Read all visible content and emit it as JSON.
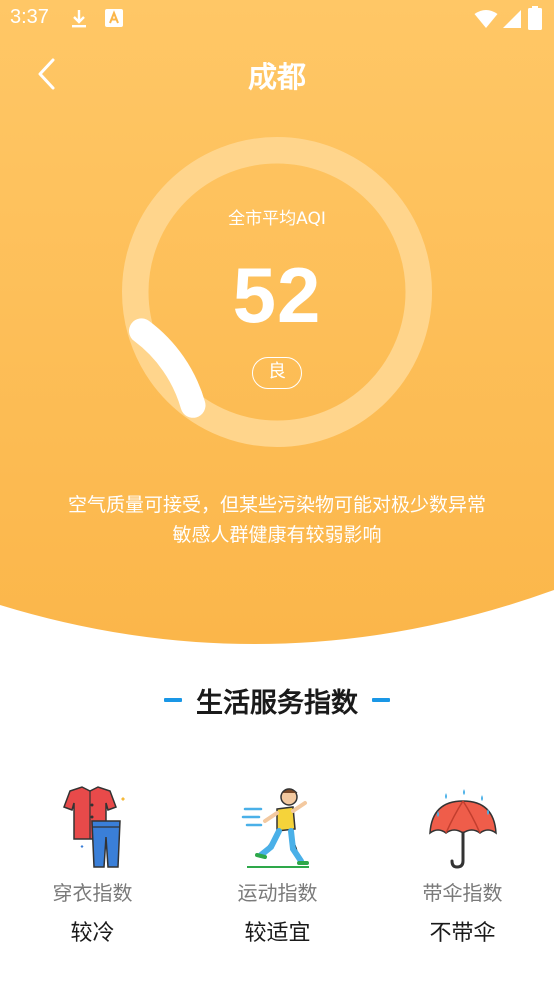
{
  "status_bar": {
    "time": "3:37"
  },
  "header": {
    "title": "成都"
  },
  "aqi": {
    "label": "全市平均AQI",
    "value": "52",
    "level": "良",
    "description": "空气质量可接受，但某些污染物可能对极少数异常敏感人群健康有较弱影响",
    "gauge_fraction": 0.104
  },
  "section": {
    "title": "生活服务指数"
  },
  "indices": [
    {
      "icon": "clothing-icon",
      "name": "穿衣指数",
      "value": "较冷"
    },
    {
      "icon": "sport-icon",
      "name": "运动指数",
      "value": "较适宜"
    },
    {
      "icon": "umbrella-icon",
      "name": "带伞指数",
      "value": "不带伞"
    }
  ],
  "colors": {
    "hero_top": "#ffc766",
    "hero_bottom": "#fbb64a",
    "accent_dash": "#1a97e6",
    "text_dark": "#1a1a1a",
    "text_gray": "#7a7a7a"
  }
}
